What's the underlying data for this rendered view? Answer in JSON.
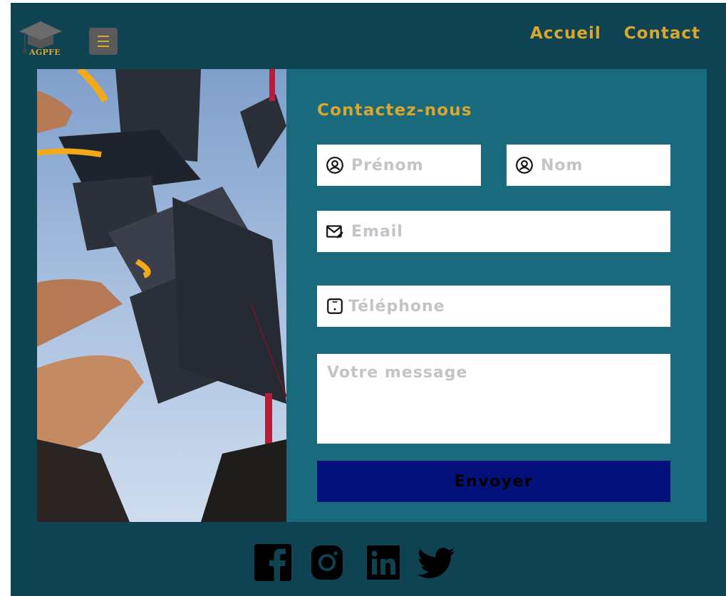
{
  "header": {
    "logo": {
      "text": "AGPFE",
      "icon": "graduation-cap-icon"
    },
    "menu_icon": "hamburger-menu-icon",
    "nav": [
      {
        "label": "Accueil"
      },
      {
        "label": "Contact"
      }
    ]
  },
  "form": {
    "title": "Contactez-nous",
    "first_name": {
      "placeholder": "Prénom",
      "value": "",
      "icon": "user-icon"
    },
    "last_name": {
      "placeholder": "Nom",
      "value": "",
      "icon": "user-icon"
    },
    "email": {
      "placeholder": "Email",
      "value": "",
      "icon": "mail-edit-icon"
    },
    "phone": {
      "placeholder": "Téléphone",
      "value": "",
      "icon": "phone-icon"
    },
    "message": {
      "placeholder": "Votre message",
      "value": ""
    },
    "submit_label": "Envoyer"
  },
  "footer": {
    "social": [
      "facebook-icon",
      "instagram-icon",
      "linkedin-icon",
      "twitter-icon"
    ]
  },
  "colors": {
    "page_bg": "#104352",
    "card_bg": "#1a6a7e",
    "accent": "#d9a62f",
    "button_bg": "#05117a"
  }
}
